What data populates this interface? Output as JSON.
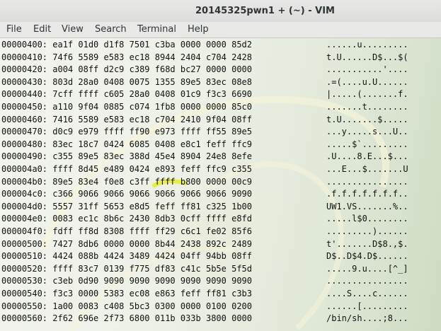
{
  "window": {
    "title": "20145325pwn1 + (~) - VIM"
  },
  "menu": [
    "File",
    "Edit",
    "View",
    "Search",
    "Terminal",
    "Help"
  ],
  "lines": [
    {
      "hex": "00000400: ea1f 01d0 d1f8 7501 c3ba 0000 0000 85d2",
      "ascii": "......u........."
    },
    {
      "hex": "00000410: 74f6 5589 e583 ec18 8944 2404 c704 2428",
      "ascii": "t.U......D$...$("
    },
    {
      "hex": "00000420: a004 08ff d2c9 c389 f68d bc27 0000 0000",
      "ascii": "...........'...."
    },
    {
      "hex": "00000430: 803d 28a0 0408 0075 1355 89e5 83ec 08e8",
      "ascii": ".=(....u.U......"
    },
    {
      "hex": "00000440: 7cff ffff c605 28a0 0408 01c9 f3c3 6690",
      "ascii": "|.....(.......f."
    },
    {
      "hex": "00000450: a110 9f04 0885 c074 1fb8 0000 0000 85c0",
      "ascii": ".......t........"
    },
    {
      "hex": "00000460: 7416 5589 e583 ec18 c704 2410 9f04 08ff",
      "ascii": "t.U.......$....."
    },
    {
      "hex": "00000470: d0c9 e979 ffff ff90 e973 ffff ff55 89e5",
      "ascii": "...y.....s...U.."
    },
    {
      "hex": "00000480: 83ec 18c7 0424 6085 0408 e8c1 feff ffc9",
      "ascii": ".....$`........."
    },
    {
      "hex": "00000490: c355 89e5 83ec 388d 45e4 8904 24e8 8efe",
      "ascii": ".U....8.E...$..."
    },
    {
      "hex": "000004a0: ffff 8d45 e489 0424 e893 feff ffc9 c355",
      "ascii": "...E...$.......U"
    },
    {
      "hex": "000004b0: 89e5 83e4 f0e8 c3ff ffff b800 0000 00c9",
      "ascii": "................"
    },
    {
      "hex": "000004c0: c366 9066 9066 9066 9066 9066 9066 9090",
      "ascii": ".f.f.f.f.f.f.f.."
    },
    {
      "hex": "000004d0: 5557 31ff 5653 e8d5 feff ff81 c325 1b00",
      "ascii": "UW1.VS.......%.."
    },
    {
      "hex": "000004e0: 0083 ec1c 8b6c 2430 8db3 0cff ffff e8fd",
      "ascii": ".....l$0........"
    },
    {
      "hex": "000004f0: fdff ff8d 8308 ffff ff29 c6c1 fe02 85f6",
      "ascii": ".........)......"
    },
    {
      "hex": "00000500: 7427 8db6 0000 0000 8b44 2438 892c 2489",
      "ascii": "t'.......D$8.,$."
    },
    {
      "hex": "00000510: 4424 088b 4424 3489 4424 04ff 94bb 08ff",
      "ascii": "D$..D$4.D$......"
    },
    {
      "hex": "00000520: ffff 83c7 0139 f775 df83 c41c 5b5e 5f5d",
      "ascii": ".....9.u....[^_]"
    },
    {
      "hex": "00000530: c3eb 0d90 9090 9090 9090 9090 9090 9090",
      "ascii": "................"
    },
    {
      "hex": "00000540: f3c3 0000 5383 ec08 e863 feff ff81 c3b3",
      "ascii": "....S....c......"
    },
    {
      "hex": "00000550: 1a00 0083 c408 5bc3 0300 0000 0100 0200",
      "ascii": "......[........."
    },
    {
      "hex": "00000560: 2f62 696e 2f73 6800 011b 033b 3800 0000",
      "ascii": "/bin/sh....;8..."
    }
  ]
}
